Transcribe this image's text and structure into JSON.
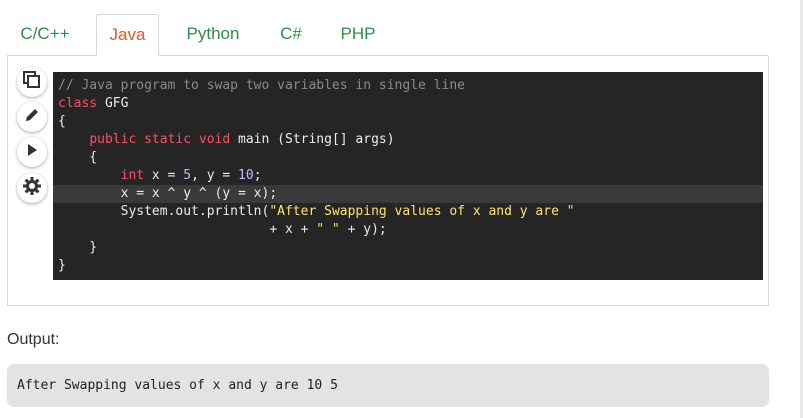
{
  "tabs": [
    {
      "label": "C/C++",
      "active": false
    },
    {
      "label": "Java",
      "active": true
    },
    {
      "label": "Python",
      "active": false
    },
    {
      "label": "C#",
      "active": false
    },
    {
      "label": "PHP",
      "active": false
    }
  ],
  "tools": [
    {
      "name": "copy-icon"
    },
    {
      "name": "edit-icon"
    },
    {
      "name": "run-icon"
    },
    {
      "name": "settings-icon"
    }
  ],
  "code": {
    "lines": [
      {
        "tokens": [
          {
            "t": "// Java program to swap two variables in single line",
            "c": "comment"
          }
        ]
      },
      {
        "tokens": [
          {
            "t": "class",
            "c": "kw"
          },
          {
            "t": " GFG",
            "c": "plain"
          }
        ]
      },
      {
        "tokens": [
          {
            "t": "{",
            "c": "plain"
          }
        ]
      },
      {
        "tokens": [
          {
            "t": "    ",
            "c": "plain"
          },
          {
            "t": "public static void",
            "c": "kw"
          },
          {
            "t": " main (String[] args)",
            "c": "plain"
          }
        ]
      },
      {
        "tokens": [
          {
            "t": "    {",
            "c": "plain"
          }
        ]
      },
      {
        "tokens": [
          {
            "t": "        ",
            "c": "plain"
          },
          {
            "t": "int",
            "c": "kw"
          },
          {
            "t": " x = ",
            "c": "plain"
          },
          {
            "t": "5",
            "c": "num"
          },
          {
            "t": ", y = ",
            "c": "plain"
          },
          {
            "t": "10",
            "c": "num"
          },
          {
            "t": ";",
            "c": "plain"
          }
        ]
      },
      {
        "tokens": [
          {
            "t": "        x = x ^ y ^ (y = x);",
            "c": "plain"
          }
        ],
        "highlight": true
      },
      {
        "tokens": [
          {
            "t": "        System.out.println(",
            "c": "plain"
          },
          {
            "t": "\"After Swapping values of x and y are \"",
            "c": "str"
          }
        ]
      },
      {
        "tokens": [
          {
            "t": "                           + x + ",
            "c": "plain"
          },
          {
            "t": "\" \"",
            "c": "str"
          },
          {
            "t": " + y);",
            "c": "plain"
          }
        ]
      },
      {
        "tokens": [
          {
            "t": "    }",
            "c": "plain"
          }
        ]
      },
      {
        "tokens": [
          {
            "t": "}",
            "c": "plain"
          }
        ]
      }
    ]
  },
  "output": {
    "label": "Output:",
    "text": "After Swapping values of x and y are 10 5"
  }
}
